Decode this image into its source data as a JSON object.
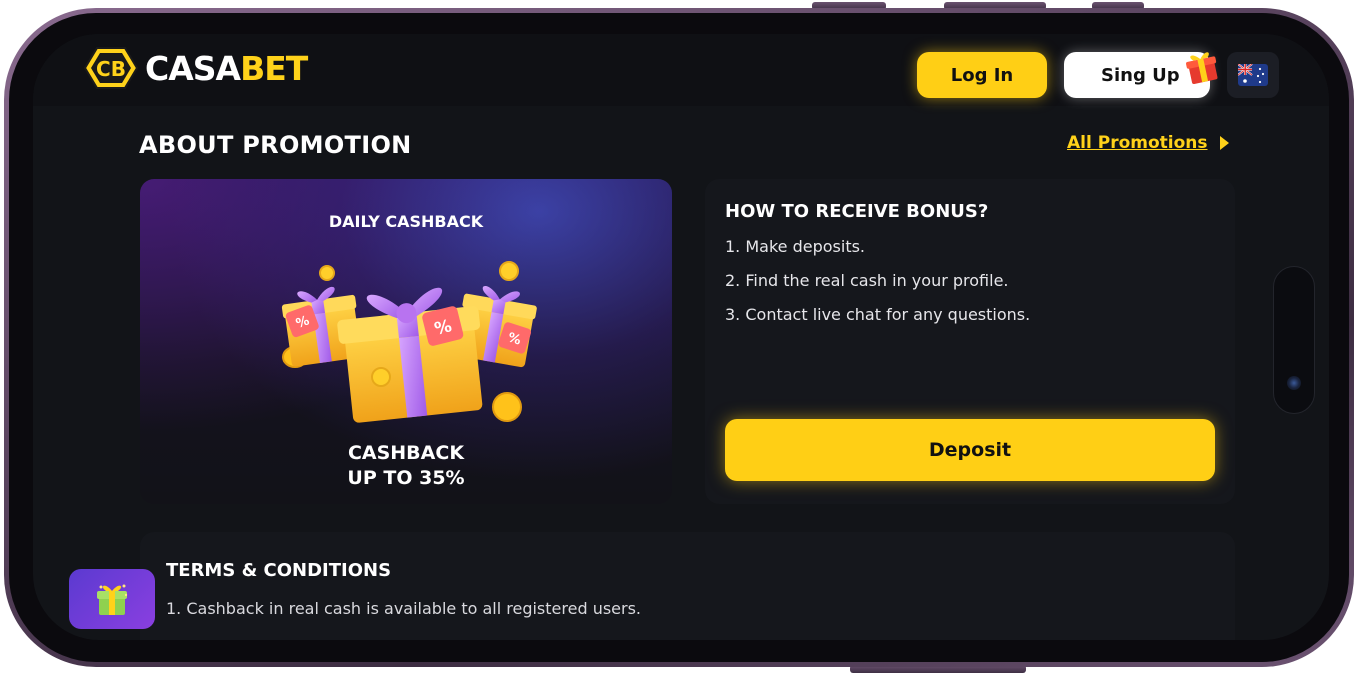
{
  "brand": {
    "logo_mark": "CB",
    "name_part1": "CASA",
    "name_part2": "BET"
  },
  "header": {
    "login_label": "Log In",
    "signup_label": "Sing Up",
    "signup_icon": "gift-icon",
    "language_icon": "australia-flag-icon"
  },
  "page": {
    "title": "ABOUT PROMOTION",
    "all_promotions_label": "All Promotions"
  },
  "promo": {
    "card_title": "DAILY CASHBACK",
    "subtitle_line1": "CASHBACK",
    "subtitle_line2": "UP TO 35%",
    "tag_symbol": "%"
  },
  "bonus": {
    "title": "HOW TO RECEIVE BONUS?",
    "steps": [
      "1. Make deposits.",
      "2. Find the real cash in your profile.",
      "3. Contact live chat for any questions."
    ],
    "deposit_label": "Deposit"
  },
  "terms": {
    "title": "TERMS & CONDITIONS",
    "items": [
      "1. Cashback in real cash is available to all registered users."
    ]
  },
  "colors": {
    "accent_yellow": "#ffcf15",
    "background": "#121418",
    "card": "#15171c",
    "purple": "#8a3fe0"
  }
}
